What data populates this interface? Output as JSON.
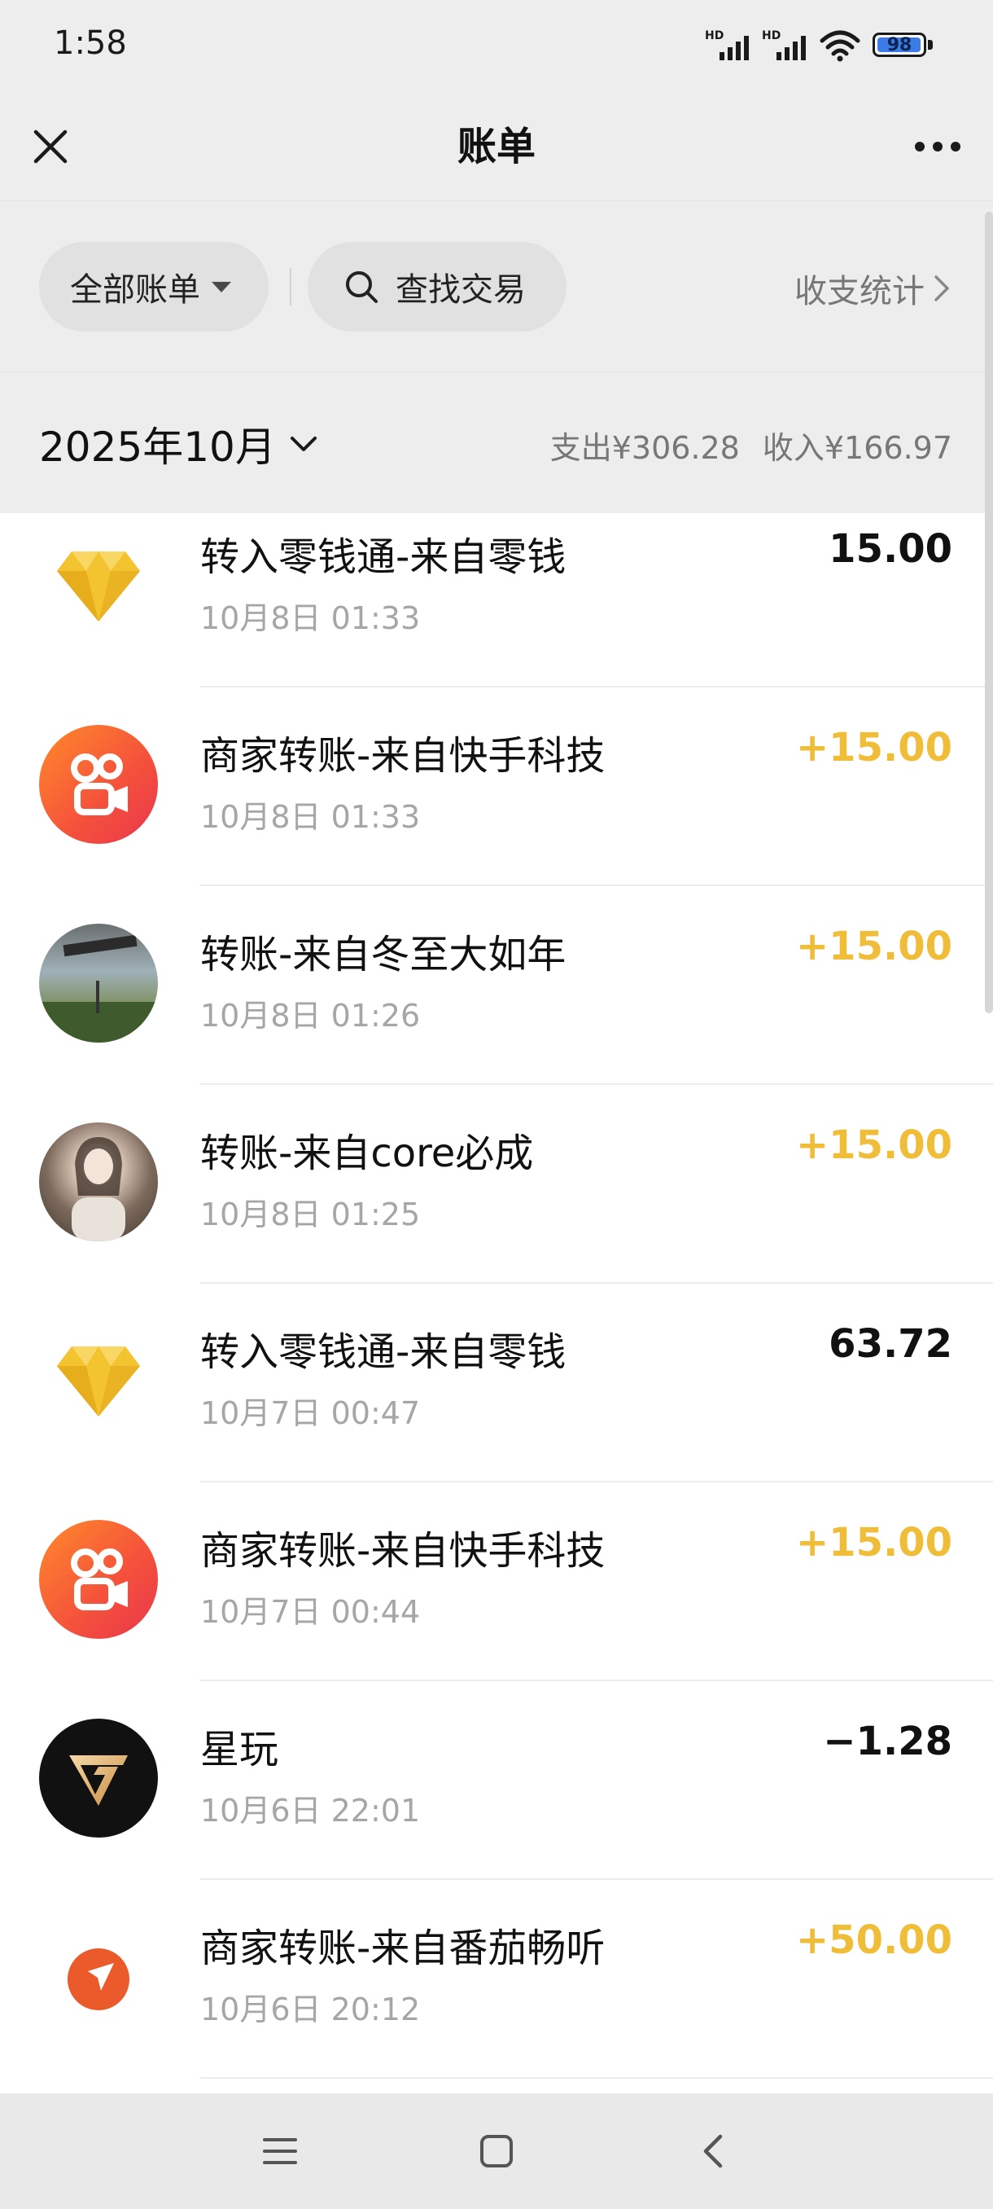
{
  "status_bar": {
    "time": "1:58",
    "signal_label_1": "HD",
    "signal_label_2": "HD",
    "battery_level": "98",
    "battery_fraction": 0.98
  },
  "nav": {
    "title": "账单"
  },
  "filters": {
    "all_bills": "全部账单",
    "search_label": "查找交易",
    "stats_link": "收支统计"
  },
  "month": {
    "label": "2025年10月",
    "expense": "支出¥306.28",
    "income": "收入¥166.97"
  },
  "transactions": [
    {
      "title": "转入零钱通-来自零钱",
      "time": "10月8日 01:33",
      "amount": "15.00",
      "kind": "neutral",
      "icon": "diamond-icon"
    },
    {
      "title": "商家转账-来自快手科技",
      "time": "10月8日 01:33",
      "amount": "+15.00",
      "kind": "income",
      "icon": "kuaishou-logo"
    },
    {
      "title": "转账-来自冬至大如年",
      "time": "10月8日 01:26",
      "amount": "+15.00",
      "kind": "income",
      "icon": "user-avatar-photo"
    },
    {
      "title": "转账-来自core必成",
      "time": "10月8日 01:25",
      "amount": "+15.00",
      "kind": "income",
      "icon": "user-avatar-photo"
    },
    {
      "title": "转入零钱通-来自零钱",
      "time": "10月7日 00:47",
      "amount": "63.72",
      "kind": "neutral",
      "icon": "diamond-icon"
    },
    {
      "title": "商家转账-来自快手科技",
      "time": "10月7日 00:44",
      "amount": "+15.00",
      "kind": "income",
      "icon": "kuaishou-logo"
    },
    {
      "title": "星玩",
      "time": "10月6日 22:01",
      "amount": "−1.28",
      "kind": "expense",
      "icon": "xingwan-logo"
    },
    {
      "title": "商家转账-来自番茄畅听",
      "time": "10月6日 20:12",
      "amount": "+50.00",
      "kind": "income",
      "icon": "fanqie-logo"
    }
  ],
  "colors": {
    "income": "#f0bd38",
    "header_bg": "#ededed",
    "text_primary": "#111111",
    "text_secondary": "#a6a6a6"
  }
}
